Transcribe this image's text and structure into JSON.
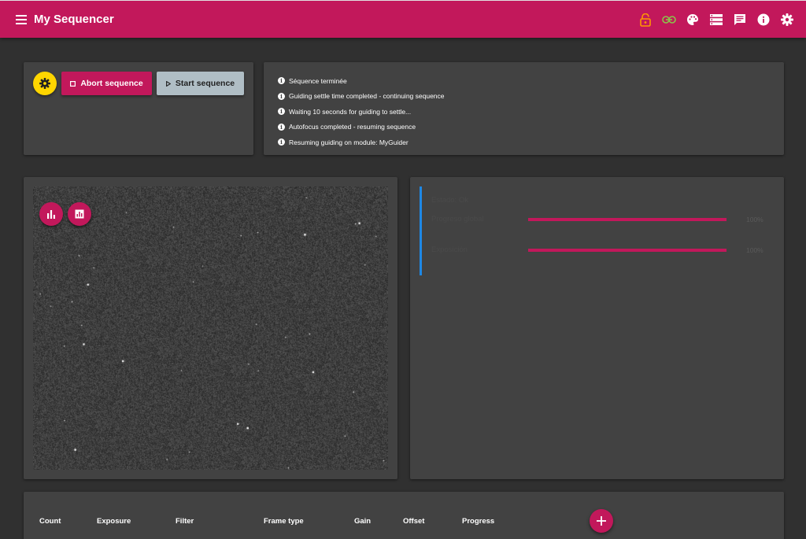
{
  "header": {
    "title": "My Sequencer",
    "icons": [
      "lock-open-icon",
      "link-icon",
      "palette-icon",
      "storage-icon",
      "notes-icon",
      "info-icon",
      "settings-icon"
    ]
  },
  "controls": {
    "abort_label": "Abort sequence",
    "start_label": "Start sequence"
  },
  "log": {
    "messages": [
      "Séquence terminée",
      "Guiding settle time completed - continuing sequence",
      "Waiting 10 seconds for guiding to settle...",
      "Autofocus completed - resuming sequence",
      "Resuming guiding on module: MyGuider"
    ]
  },
  "status": {
    "state": "Estado: Ok",
    "global_label": "Progreso global",
    "global_value": "100%",
    "global_fraction": 1.0,
    "exposure_label": "Exposición",
    "exposure_value": "100%",
    "exposure_fraction": 1.0
  },
  "table": {
    "columns": [
      "Count",
      "Exposure",
      "Filter",
      "Frame type",
      "Gain",
      "Offset",
      "Progress"
    ]
  },
  "colors": {
    "primary": "#c2185b",
    "accent_yellow": "#ffd600",
    "status_blue": "#1e88e5",
    "background": "#303030",
    "card": "#424242"
  }
}
